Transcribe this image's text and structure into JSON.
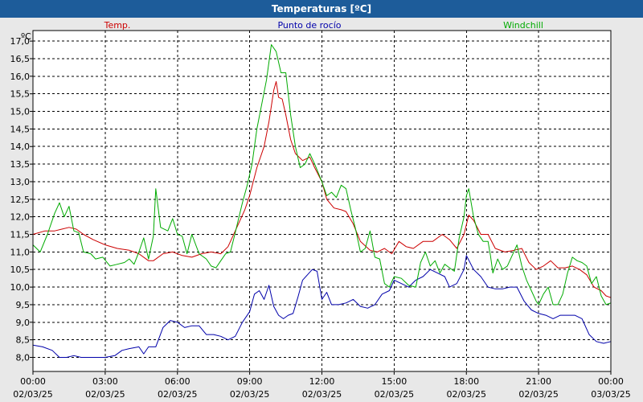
{
  "chart_data": {
    "type": "line",
    "title": "Temperaturas [ºC]",
    "ylabel": "ºC",
    "ylim": [
      7.6,
      17.3
    ],
    "grid": true,
    "y_ticks": [
      "8,0",
      "8,5",
      "9,0",
      "9,5",
      "10,0",
      "10,5",
      "11,0",
      "11,5",
      "12,0",
      "12,5",
      "13,0",
      "13,5",
      "14,0",
      "14,5",
      "15,0",
      "15,5",
      "16,0",
      "16,5",
      "17,0"
    ],
    "x_ticks": [
      {
        "time": "00:00",
        "date": "02/03/25"
      },
      {
        "time": "03:00",
        "date": "02/03/25"
      },
      {
        "time": "06:00",
        "date": "02/03/25"
      },
      {
        "time": "09:00",
        "date": "02/03/25"
      },
      {
        "time": "12:00",
        "date": "02/03/25"
      },
      {
        "time": "15:00",
        "date": "02/03/25"
      },
      {
        "time": "18:00",
        "date": "02/03/25"
      },
      {
        "time": "21:00",
        "date": "02/03/25"
      },
      {
        "time": "00:00",
        "date": "03/03/25"
      }
    ],
    "x_range_hours": [
      0,
      24
    ],
    "series": [
      {
        "name": "Temp.",
        "color": "#cc0000",
        "points": [
          [
            0.0,
            11.5
          ],
          [
            0.5,
            11.6
          ],
          [
            0.9,
            11.6
          ],
          [
            1.2,
            11.65
          ],
          [
            1.5,
            11.7
          ],
          [
            1.8,
            11.65
          ],
          [
            2.1,
            11.5
          ],
          [
            2.5,
            11.35
          ],
          [
            3.0,
            11.2
          ],
          [
            3.5,
            11.1
          ],
          [
            4.0,
            11.05
          ],
          [
            4.4,
            10.95
          ],
          [
            4.8,
            10.75
          ],
          [
            5.0,
            10.75
          ],
          [
            5.4,
            10.95
          ],
          [
            5.8,
            11.0
          ],
          [
            6.2,
            10.9
          ],
          [
            6.6,
            10.85
          ],
          [
            7.0,
            10.95
          ],
          [
            7.4,
            11.0
          ],
          [
            7.8,
            10.95
          ],
          [
            8.1,
            11.15
          ],
          [
            8.4,
            11.6
          ],
          [
            8.8,
            12.2
          ],
          [
            9.0,
            12.6
          ],
          [
            9.3,
            13.4
          ],
          [
            9.6,
            14.0
          ],
          [
            9.8,
            14.7
          ],
          [
            10.0,
            15.6
          ],
          [
            10.1,
            15.85
          ],
          [
            10.2,
            15.4
          ],
          [
            10.35,
            15.35
          ],
          [
            10.5,
            14.9
          ],
          [
            10.7,
            14.2
          ],
          [
            10.9,
            13.8
          ],
          [
            11.2,
            13.6
          ],
          [
            11.5,
            13.7
          ],
          [
            11.7,
            13.4
          ],
          [
            12.0,
            13.0
          ],
          [
            12.2,
            12.5
          ],
          [
            12.5,
            12.25
          ],
          [
            12.8,
            12.2
          ],
          [
            13.0,
            12.15
          ],
          [
            13.3,
            11.8
          ],
          [
            13.6,
            11.3
          ],
          [
            14.0,
            11.05
          ],
          [
            14.3,
            11.0
          ],
          [
            14.6,
            11.1
          ],
          [
            14.9,
            10.95
          ],
          [
            15.2,
            11.3
          ],
          [
            15.5,
            11.15
          ],
          [
            15.8,
            11.1
          ],
          [
            16.2,
            11.3
          ],
          [
            16.6,
            11.3
          ],
          [
            17.0,
            11.5
          ],
          [
            17.3,
            11.35
          ],
          [
            17.6,
            11.1
          ],
          [
            17.9,
            11.5
          ],
          [
            18.1,
            12.05
          ],
          [
            18.3,
            11.9
          ],
          [
            18.6,
            11.5
          ],
          [
            18.9,
            11.5
          ],
          [
            19.2,
            11.1
          ],
          [
            19.6,
            11.0
          ],
          [
            20.0,
            11.05
          ],
          [
            20.3,
            11.1
          ],
          [
            20.6,
            10.7
          ],
          [
            20.9,
            10.5
          ],
          [
            21.2,
            10.6
          ],
          [
            21.5,
            10.75
          ],
          [
            21.8,
            10.55
          ],
          [
            22.1,
            10.55
          ],
          [
            22.4,
            10.6
          ],
          [
            22.7,
            10.5
          ],
          [
            23.0,
            10.35
          ],
          [
            23.3,
            10.0
          ],
          [
            23.6,
            9.9
          ],
          [
            23.8,
            9.75
          ],
          [
            24.0,
            9.7
          ]
        ]
      },
      {
        "name": "Punto de rocío",
        "color": "#0000aa",
        "points": [
          [
            0.0,
            8.35
          ],
          [
            0.4,
            8.3
          ],
          [
            0.8,
            8.2
          ],
          [
            1.1,
            8.0
          ],
          [
            1.4,
            8.0
          ],
          [
            1.7,
            8.05
          ],
          [
            2.0,
            8.0
          ],
          [
            2.5,
            8.0
          ],
          [
            3.0,
            8.0
          ],
          [
            3.4,
            8.05
          ],
          [
            3.7,
            8.2
          ],
          [
            4.0,
            8.25
          ],
          [
            4.4,
            8.3
          ],
          [
            4.6,
            8.1
          ],
          [
            4.8,
            8.3
          ],
          [
            5.1,
            8.3
          ],
          [
            5.4,
            8.85
          ],
          [
            5.7,
            9.05
          ],
          [
            6.0,
            9.0
          ],
          [
            6.3,
            8.85
          ],
          [
            6.6,
            8.9
          ],
          [
            6.9,
            8.9
          ],
          [
            7.2,
            8.65
          ],
          [
            7.5,
            8.65
          ],
          [
            7.8,
            8.6
          ],
          [
            8.1,
            8.5
          ],
          [
            8.4,
            8.6
          ],
          [
            8.7,
            9.0
          ],
          [
            9.0,
            9.3
          ],
          [
            9.2,
            9.8
          ],
          [
            9.4,
            9.9
          ],
          [
            9.6,
            9.65
          ],
          [
            9.8,
            10.05
          ],
          [
            10.0,
            9.45
          ],
          [
            10.2,
            9.2
          ],
          [
            10.4,
            9.1
          ],
          [
            10.6,
            9.2
          ],
          [
            10.8,
            9.25
          ],
          [
            11.0,
            9.7
          ],
          [
            11.2,
            10.2
          ],
          [
            11.4,
            10.35
          ],
          [
            11.6,
            10.5
          ],
          [
            11.8,
            10.45
          ],
          [
            12.0,
            9.65
          ],
          [
            12.2,
            9.85
          ],
          [
            12.4,
            9.5
          ],
          [
            12.7,
            9.5
          ],
          [
            13.0,
            9.55
          ],
          [
            13.3,
            9.65
          ],
          [
            13.6,
            9.45
          ],
          [
            13.9,
            9.4
          ],
          [
            14.2,
            9.5
          ],
          [
            14.5,
            9.8
          ],
          [
            14.8,
            9.9
          ],
          [
            15.0,
            10.2
          ],
          [
            15.3,
            10.1
          ],
          [
            15.6,
            10.0
          ],
          [
            15.9,
            10.2
          ],
          [
            16.2,
            10.3
          ],
          [
            16.5,
            10.5
          ],
          [
            16.8,
            10.4
          ],
          [
            17.1,
            10.3
          ],
          [
            17.3,
            10.0
          ],
          [
            17.6,
            10.1
          ],
          [
            17.9,
            10.5
          ],
          [
            18.0,
            10.9
          ],
          [
            18.3,
            10.5
          ],
          [
            18.6,
            10.3
          ],
          [
            18.9,
            10.0
          ],
          [
            19.2,
            9.95
          ],
          [
            19.5,
            9.95
          ],
          [
            19.8,
            10.0
          ],
          [
            20.1,
            10.0
          ],
          [
            20.4,
            9.6
          ],
          [
            20.7,
            9.35
          ],
          [
            21.0,
            9.25
          ],
          [
            21.3,
            9.2
          ],
          [
            21.6,
            9.1
          ],
          [
            21.9,
            9.2
          ],
          [
            22.2,
            9.2
          ],
          [
            22.5,
            9.2
          ],
          [
            22.8,
            9.1
          ],
          [
            23.1,
            8.65
          ],
          [
            23.4,
            8.45
          ],
          [
            23.7,
            8.4
          ],
          [
            24.0,
            8.45
          ]
        ]
      },
      {
        "name": "Windchill",
        "color": "#00aa00",
        "points": [
          [
            0.0,
            11.2
          ],
          [
            0.3,
            11.0
          ],
          [
            0.6,
            11.5
          ],
          [
            0.9,
            12.1
          ],
          [
            1.1,
            12.4
          ],
          [
            1.3,
            12.0
          ],
          [
            1.5,
            12.3
          ],
          [
            1.7,
            11.6
          ],
          [
            1.9,
            11.55
          ],
          [
            2.1,
            11.0
          ],
          [
            2.4,
            10.95
          ],
          [
            2.6,
            10.8
          ],
          [
            2.9,
            10.85
          ],
          [
            3.2,
            10.6
          ],
          [
            3.5,
            10.65
          ],
          [
            3.8,
            10.7
          ],
          [
            4.0,
            10.8
          ],
          [
            4.2,
            10.65
          ],
          [
            4.4,
            11.0
          ],
          [
            4.6,
            11.4
          ],
          [
            4.8,
            10.8
          ],
          [
            5.0,
            11.45
          ],
          [
            5.1,
            12.8
          ],
          [
            5.3,
            11.7
          ],
          [
            5.6,
            11.6
          ],
          [
            5.8,
            11.95
          ],
          [
            6.0,
            11.5
          ],
          [
            6.2,
            11.45
          ],
          [
            6.4,
            10.95
          ],
          [
            6.6,
            11.5
          ],
          [
            6.9,
            10.95
          ],
          [
            7.2,
            10.8
          ],
          [
            7.4,
            10.6
          ],
          [
            7.6,
            10.55
          ],
          [
            7.8,
            10.75
          ],
          [
            8.0,
            10.95
          ],
          [
            8.2,
            11.0
          ],
          [
            8.4,
            11.55
          ],
          [
            8.7,
            12.4
          ],
          [
            8.9,
            12.9
          ],
          [
            9.1,
            13.5
          ],
          [
            9.3,
            14.5
          ],
          [
            9.5,
            15.2
          ],
          [
            9.7,
            15.9
          ],
          [
            9.9,
            16.9
          ],
          [
            10.1,
            16.7
          ],
          [
            10.3,
            16.1
          ],
          [
            10.5,
            16.1
          ],
          [
            10.7,
            14.9
          ],
          [
            10.9,
            14.0
          ],
          [
            11.1,
            13.4
          ],
          [
            11.3,
            13.5
          ],
          [
            11.5,
            13.8
          ],
          [
            11.7,
            13.5
          ],
          [
            12.0,
            13.0
          ],
          [
            12.2,
            12.6
          ],
          [
            12.4,
            12.7
          ],
          [
            12.6,
            12.55
          ],
          [
            12.8,
            12.9
          ],
          [
            13.0,
            12.8
          ],
          [
            13.2,
            12.2
          ],
          [
            13.4,
            11.65
          ],
          [
            13.6,
            11.0
          ],
          [
            13.8,
            11.1
          ],
          [
            14.0,
            11.6
          ],
          [
            14.2,
            10.85
          ],
          [
            14.4,
            10.8
          ],
          [
            14.6,
            10.1
          ],
          [
            14.8,
            10.0
          ],
          [
            15.0,
            10.3
          ],
          [
            15.3,
            10.25
          ],
          [
            15.6,
            10.05
          ],
          [
            15.9,
            10.0
          ],
          [
            16.1,
            10.7
          ],
          [
            16.3,
            11.0
          ],
          [
            16.5,
            10.6
          ],
          [
            16.7,
            10.75
          ],
          [
            16.9,
            10.4
          ],
          [
            17.1,
            10.65
          ],
          [
            17.3,
            10.55
          ],
          [
            17.5,
            10.45
          ],
          [
            17.7,
            11.4
          ],
          [
            17.9,
            12.0
          ],
          [
            18.0,
            12.6
          ],
          [
            18.1,
            12.8
          ],
          [
            18.3,
            12.0
          ],
          [
            18.5,
            11.5
          ],
          [
            18.7,
            11.3
          ],
          [
            18.9,
            11.3
          ],
          [
            19.0,
            10.9
          ],
          [
            19.1,
            10.4
          ],
          [
            19.3,
            10.8
          ],
          [
            19.5,
            10.5
          ],
          [
            19.7,
            10.6
          ],
          [
            19.9,
            10.9
          ],
          [
            20.1,
            11.2
          ],
          [
            20.3,
            10.6
          ],
          [
            20.5,
            10.2
          ],
          [
            20.7,
            9.9
          ],
          [
            20.9,
            9.6
          ],
          [
            21.0,
            9.5
          ],
          [
            21.2,
            9.8
          ],
          [
            21.4,
            10.0
          ],
          [
            21.6,
            9.5
          ],
          [
            21.8,
            9.5
          ],
          [
            22.0,
            9.8
          ],
          [
            22.2,
            10.4
          ],
          [
            22.4,
            10.85
          ],
          [
            22.6,
            10.75
          ],
          [
            22.8,
            10.7
          ],
          [
            23.0,
            10.6
          ],
          [
            23.2,
            10.1
          ],
          [
            23.4,
            10.3
          ],
          [
            23.6,
            9.75
          ],
          [
            23.8,
            9.5
          ],
          [
            24.0,
            9.55
          ]
        ]
      }
    ]
  }
}
